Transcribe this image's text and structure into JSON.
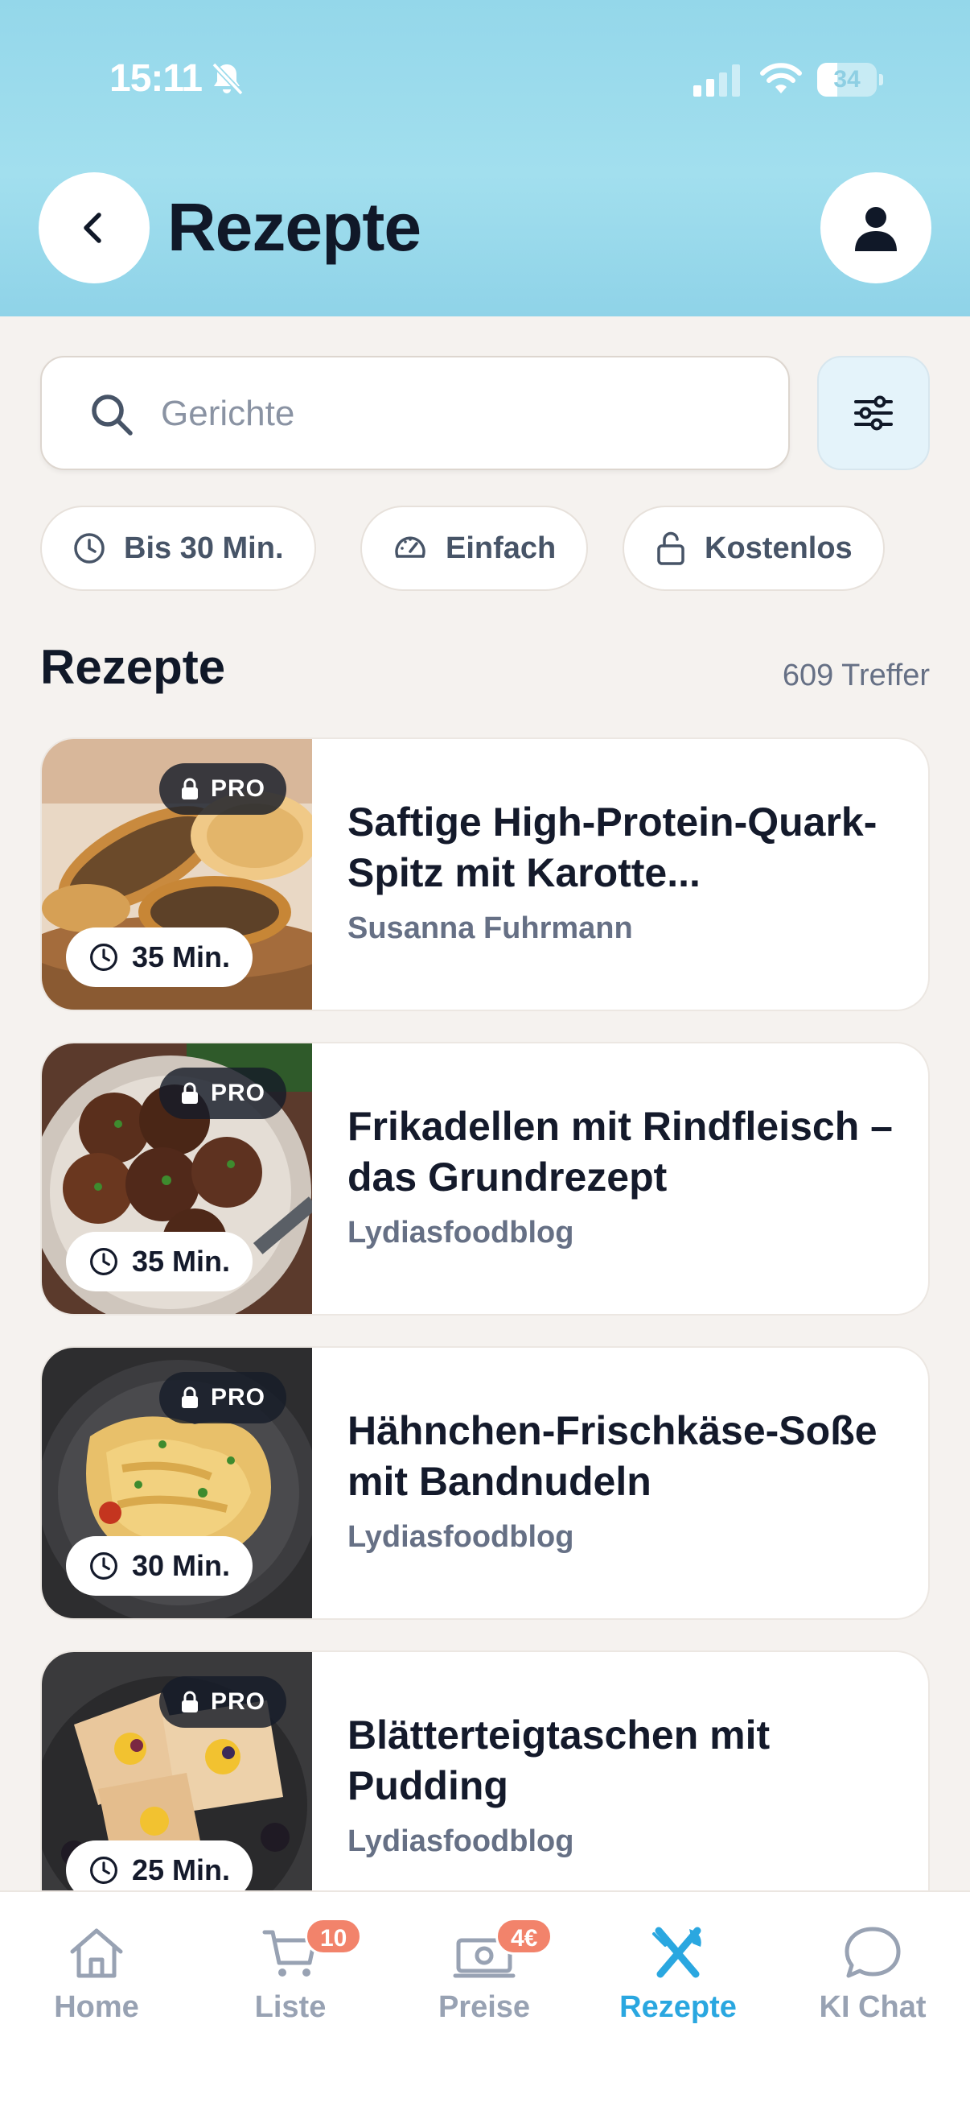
{
  "status_bar": {
    "time": "15:11",
    "battery": "34",
    "battery_level": 0.34,
    "icons": [
      "bell-slash-icon",
      "signal-icon",
      "wifi-icon",
      "battery-icon"
    ]
  },
  "header": {
    "title": "Rezepte",
    "back_icon": "chevron-left-icon",
    "profile_icon": "user-icon"
  },
  "search": {
    "placeholder": "Gerichte",
    "value": "",
    "filter_icon": "sliders-icon"
  },
  "chips": [
    {
      "label": "Bis 30 Min.",
      "icon": "clock-icon"
    },
    {
      "label": "Einfach",
      "icon": "gauge-icon"
    },
    {
      "label": "Kostenlos",
      "icon": "unlock-icon"
    }
  ],
  "section": {
    "title": "Rezepte",
    "count": "609 Treffer"
  },
  "recipes": [
    {
      "title": "Saftige High-Protein-Quark-Spitz mit Karotte...",
      "author": "Susanna Fuhrmann",
      "time": "35 Min.",
      "badge": "PRO"
    },
    {
      "title": "Frikadellen mit Rindfleisch – das Grundrezept",
      "author": "Lydiasfoodblog",
      "time": "35 Min.",
      "badge": "PRO"
    },
    {
      "title": "Hähnchen-Frischkäse-Soße mit Bandnudeln",
      "author": "Lydiasfoodblog",
      "time": "30 Min.",
      "badge": "PRO"
    },
    {
      "title": "Blätterteigtaschen mit Pudding",
      "author": "Lydiasfoodblog",
      "time": "25 Min.",
      "badge": "PRO"
    }
  ],
  "tabs": [
    {
      "label": "Home",
      "icon": "home-icon",
      "badge": ""
    },
    {
      "label": "Liste",
      "icon": "cart-icon",
      "badge": "10"
    },
    {
      "label": "Preise",
      "icon": "money-icon",
      "badge": "4€"
    },
    {
      "label": "Rezepte",
      "icon": "utensils-icon",
      "badge": "",
      "active": true
    },
    {
      "label": "KI Chat",
      "icon": "chat-icon",
      "badge": ""
    }
  ],
  "colors": {
    "header_bg": "#9adbec",
    "accent": "#2aa7e0",
    "badge": "#f2836b",
    "text_dark": "#141a2b",
    "text_muted": "#667085"
  }
}
